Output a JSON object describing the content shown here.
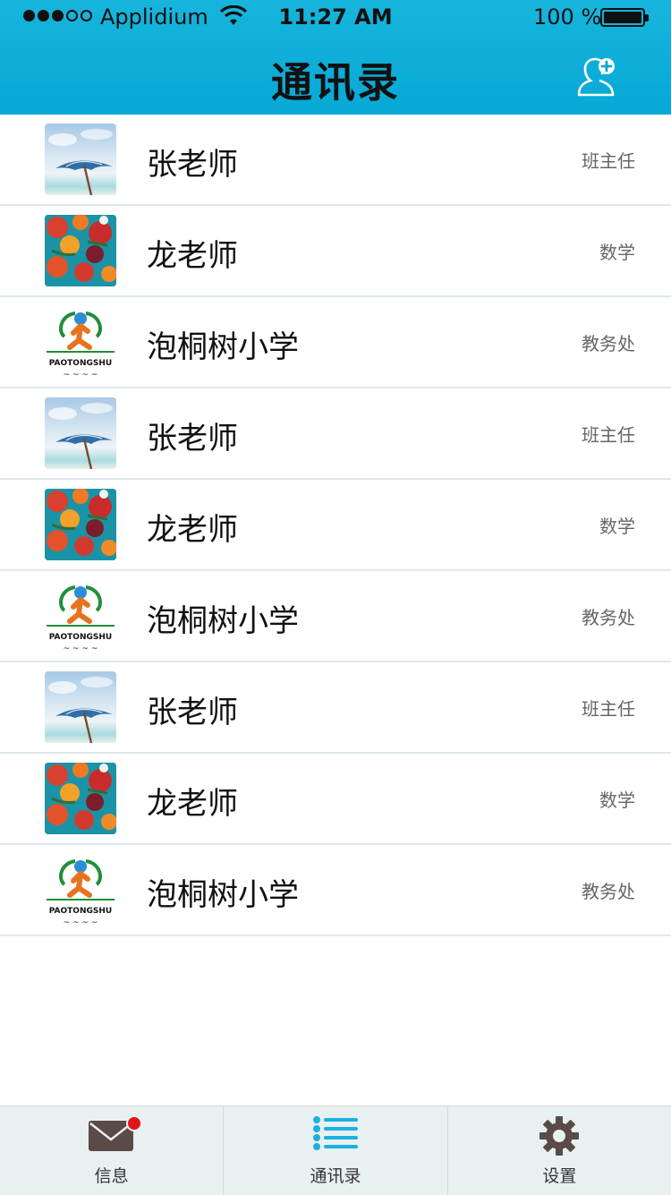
{
  "status_bar": {
    "carrier": "Applidium",
    "time": "11:27 AM",
    "battery_percent": "100 %"
  },
  "header": {
    "title": "通讯录",
    "add_contact_icon": "add-contact-icon"
  },
  "contacts": [
    {
      "name": "张老师",
      "role": "班主任",
      "avatar": "umbrella"
    },
    {
      "name": "龙老师",
      "role": "数学",
      "avatar": "flower"
    },
    {
      "name": "泡桐树小学",
      "role": "教务处",
      "avatar": "school-logo"
    },
    {
      "name": "张老师",
      "role": "班主任",
      "avatar": "umbrella"
    },
    {
      "name": "龙老师",
      "role": "数学",
      "avatar": "flower"
    },
    {
      "name": "泡桐树小学",
      "role": "教务处",
      "avatar": "school-logo"
    },
    {
      "name": "张老师",
      "role": "班主任",
      "avatar": "umbrella"
    },
    {
      "name": "龙老师",
      "role": "数学",
      "avatar": "flower"
    },
    {
      "name": "泡桐树小学",
      "role": "教务处",
      "avatar": "school-logo"
    }
  ],
  "school_logo_text": "PAOTONGSHU",
  "tabs": [
    {
      "label": "信息",
      "icon": "mail-icon",
      "badge": true
    },
    {
      "label": "通讯录",
      "icon": "list-icon",
      "active": true
    },
    {
      "label": "设置",
      "icon": "gear-icon"
    }
  ],
  "colors": {
    "header": "#07a8d6",
    "accent": "#1bb1e0",
    "badge": "#e01515",
    "tab_icon": "#5a4b46"
  }
}
